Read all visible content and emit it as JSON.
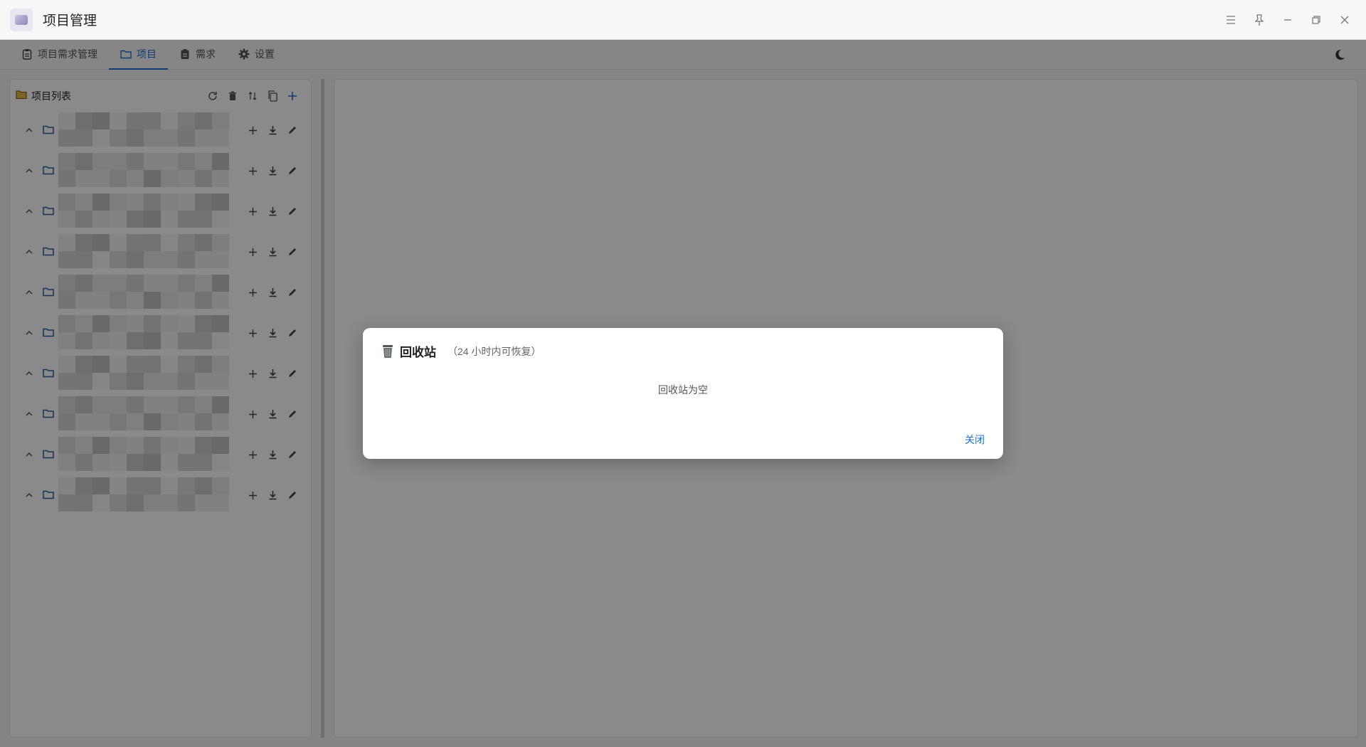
{
  "window": {
    "title": "项目管理"
  },
  "tabs": [
    {
      "label": "项目需求管理",
      "icon": "clipboard-icon",
      "active": false
    },
    {
      "label": "项目",
      "icon": "folder-icon",
      "active": true
    },
    {
      "label": "需求",
      "icon": "clipboard-icon",
      "active": false
    },
    {
      "label": "设置",
      "icon": "gear-icon",
      "active": false
    }
  ],
  "sidebar": {
    "title": "项目列表",
    "tools": [
      "refresh-icon",
      "trash-icon",
      "sort-icon",
      "copy-icon",
      "plus-icon"
    ],
    "project_count": 10
  },
  "dialog": {
    "title": "回收站",
    "subtitle": "（24 小时内可恢复）",
    "empty_text": "回收站为空",
    "close_label": "关闭"
  },
  "colors": {
    "accent": "#1f6fd1",
    "folder": "#2b5ea8",
    "overlay": "rgba(0,0,0,0.46)"
  }
}
